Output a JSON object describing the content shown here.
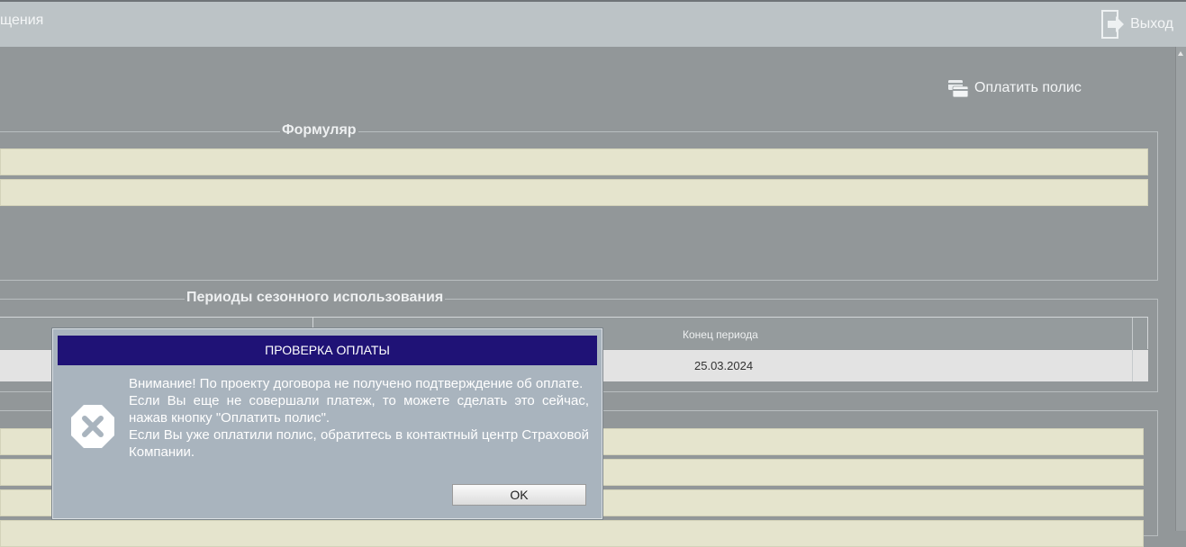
{
  "topbar": {
    "partial_text": "щения",
    "exit_label": "Выход"
  },
  "actions": {
    "pay_label": "Оплатить полис"
  },
  "sections": {
    "form_title": "Формуляр",
    "seasonal_title": "Периоды сезонного использования",
    "table": {
      "column_end": "Конец периода",
      "row_end_value": "25.03.2024"
    }
  },
  "dialog": {
    "title": "ПРОВЕРКА ОПЛАТЫ",
    "lines": [
      "Внимание! По проекту договора не получено подтверждение об оплате.",
      "Если Вы еще не совершали платеж, то можете сделать это сейчас, нажав кнопку \"Оплатить полис\".",
      "Если Вы уже оплатили полис, обратитесь в контактный центр Страховой Компании."
    ],
    "ok_label": "OK",
    "icon": "error-x-icon"
  },
  "colors": {
    "background": "#929799",
    "topbar": "#bcc3c6",
    "field_fill": "#e5e4cd",
    "dialog_title": "#1f1276",
    "dialog_body": "#a9b4be"
  }
}
